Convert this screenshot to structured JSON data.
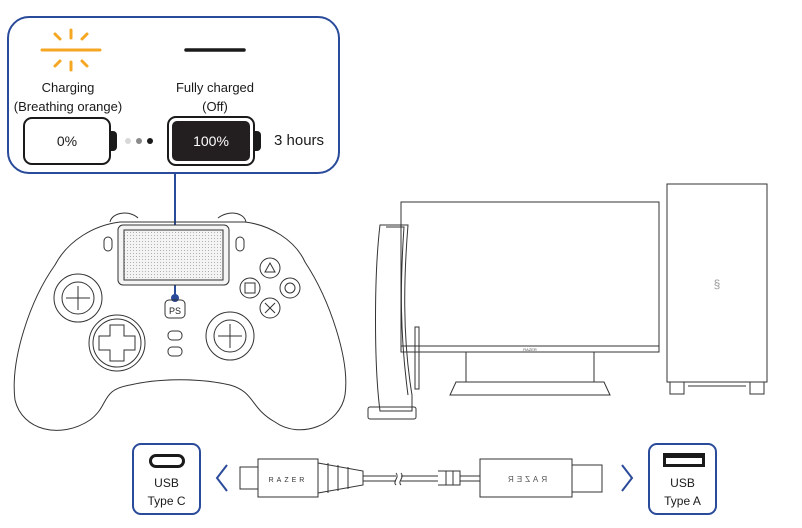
{
  "callout": {
    "charging": {
      "indicator_icon": "sun-burst-led-icon",
      "indicator_color": "#f5a623",
      "title": "Charging",
      "subtitle": "(Breathing orange)",
      "battery_label": "0%"
    },
    "full": {
      "indicator_icon": "led-off-line-icon",
      "indicator_color": "#1a1a1a",
      "title": "Fully charged",
      "subtitle": "(Off)",
      "battery_label": "100%"
    },
    "duration": "3 hours",
    "border_color": "#2a4a9a"
  },
  "devices": {
    "controller": "gamepad-controller",
    "console": "game-console",
    "monitor_brand": "RAZER",
    "pc": "desktop-pc-tower"
  },
  "cable": {
    "left_port": {
      "line1": "USB",
      "line2": "Type C",
      "icon": "usb-c-port-icon"
    },
    "right_port": {
      "line1": "USB",
      "line2": "Type A",
      "icon": "usb-a-port-icon"
    },
    "brand_left": "RAZER",
    "brand_right": "RAZER"
  }
}
